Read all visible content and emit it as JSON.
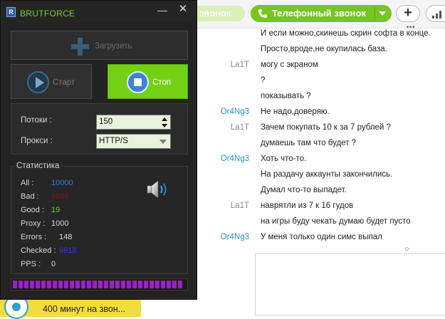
{
  "chat": {
    "voice_call_label": "звонок",
    "phone_call_label": "Телефонный звонок",
    "plus_label": "+",
    "messages": [
      {
        "sender": "",
        "text": "И если можно,скинешь скрин софта в конце.",
        "sender_color": "gray"
      },
      {
        "sender": "",
        "text": "Просто,вроде,не окупилась база.",
        "sender_color": "gray"
      },
      {
        "sender": "La1T",
        "text": "могу с экраном",
        "sender_color": "gray"
      },
      {
        "sender": "",
        "text": "?",
        "sender_color": "gray"
      },
      {
        "sender": "",
        "text": "показывать ?",
        "sender_color": "gray"
      },
      {
        "sender": "Or4Ng3",
        "text": "Не надо,доверяю.",
        "sender_color": "blue"
      },
      {
        "sender": "La1T",
        "text": "Зачем покупать 10 к за 7 рублей ?",
        "sender_color": "gray"
      },
      {
        "sender": "",
        "text": "думаешь там что будет ?",
        "sender_color": "gray"
      },
      {
        "sender": "Or4Ng3",
        "text": "Хоть что-то.",
        "sender_color": "blue"
      },
      {
        "sender": "",
        "text": "На раздачу аккаунты закончились.",
        "sender_color": "gray"
      },
      {
        "sender": "",
        "text": "Думал что-то выпадет.",
        "sender_color": "gray"
      },
      {
        "sender": "La1T",
        "text": "наврятли из 7 к 16 гудов",
        "sender_color": "gray"
      },
      {
        "sender": "",
        "text": "на игры буду чекать думаю будет пусто",
        "sender_color": "gray"
      },
      {
        "sender": "Or4Ng3",
        "text": "У меня только один симс выпал",
        "sender_color": "blue"
      }
    ],
    "ad_text": "400 минут на звон..."
  },
  "brutforce": {
    "title": "BRUTFORCE",
    "logo_letter": "R",
    "minimize_label": "—",
    "close_label": "✕",
    "load_label": "Загрузить",
    "start_label": "Старт",
    "stop_label": "Стоп",
    "threads_label": "Потоки :",
    "threads_value": "150",
    "proxy_label": "Прокси :",
    "proxy_value": "HTTP/S",
    "stats_title": "Статистика",
    "stats": [
      {
        "label": "All :",
        "value": "10000",
        "color": "#2f7fe0"
      },
      {
        "label": "Bad :",
        "value": "9984",
        "color": "#7a1a1a"
      },
      {
        "label": "Good :",
        "value": "19",
        "color": "#6fd12b"
      },
      {
        "label": "Proxy :",
        "value": "1000",
        "color": "#d6d6d6"
      },
      {
        "label": "Errors :",
        "value": "148",
        "color": "#d6d6d6"
      },
      {
        "label": "Checked :",
        "value": "9918",
        "color": "#3a3ad6"
      },
      {
        "label": "PPS :",
        "value": "0",
        "color": "#d6d6d6"
      }
    ],
    "progress_fraction": 1.0
  },
  "colors": {
    "accent_green": "#73d114",
    "progress_purple": "#9c20c8",
    "window_bg": "#232323"
  }
}
